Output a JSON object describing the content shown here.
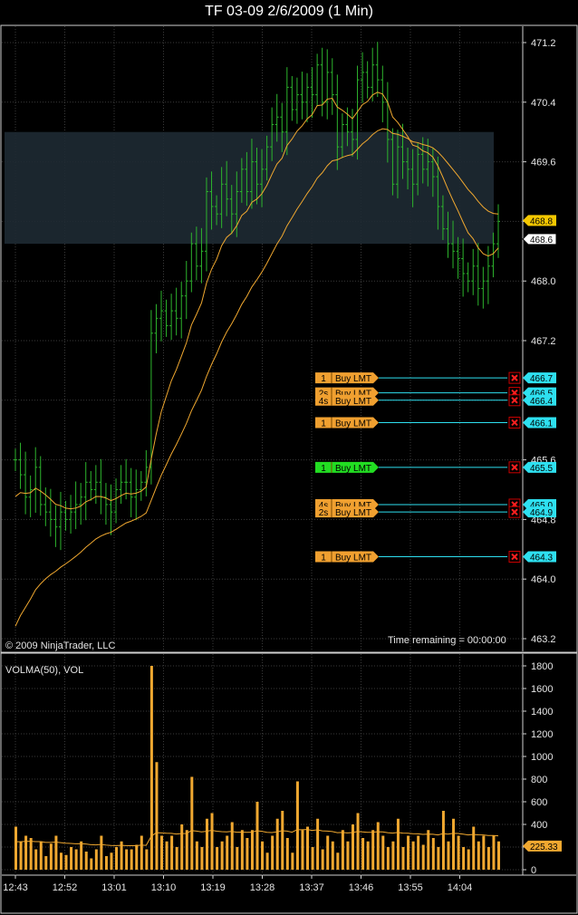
{
  "window": {
    "title": "TF 03-09  2/6/2009 (1 Min)"
  },
  "price_panel": {
    "copyright": "© 2009 NinjaTrader, LLC",
    "time_remaining": "Time remaining = 00:00:00",
    "last_price_label": "468.8",
    "ask_price_label": "468.6"
  },
  "volume_panel": {
    "label": "VOLMA(50), VOL",
    "current_volma_label": "225.33"
  },
  "colors": {
    "background": "#000000",
    "bars": "#2db52d",
    "moving_average": "#f0a830",
    "volume": "#f0a830",
    "order_orange": "#f0a030",
    "order_green": "#22dd22",
    "order_line": "#2ee0f0",
    "zone": "#1e2a33"
  },
  "orders": [
    {
      "qty": "1",
      "type": "Buy LMT",
      "price": "466.7",
      "color": "orange"
    },
    {
      "qty": "2s",
      "type": "Buy LMT",
      "price": "466.5",
      "color": "orange"
    },
    {
      "qty": "4s",
      "type": "Buy LMT",
      "price": "466.4",
      "color": "orange"
    },
    {
      "qty": "1",
      "type": "Buy LMT",
      "price": "466.1",
      "color": "orange"
    },
    {
      "qty": "1",
      "type": "Buy LMT",
      "price": "465.5",
      "color": "green"
    },
    {
      "qty": "4s",
      "type": "Buy LMT",
      "price": "465.0",
      "color": "orange"
    },
    {
      "qty": "2s",
      "type": "Buy LMT",
      "price": "464.9",
      "color": "orange"
    },
    {
      "qty": "1",
      "type": "Buy LMT",
      "price": "464.3",
      "color": "orange"
    }
  ],
  "chart_data": {
    "type": "ohlc_with_volume",
    "instrument": "TF 03-09",
    "date": "2/6/2009",
    "interval": "1 Min",
    "price_axis": {
      "ylim": [
        463.0,
        471.4
      ],
      "ticks": [
        "471.2",
        "470.4",
        "469.6",
        "468.8",
        "468.0",
        "467.2",
        "466.4",
        "465.6",
        "464.8",
        "464.0",
        "463.2"
      ]
    },
    "volume_axis": {
      "ylim": [
        0,
        1800
      ],
      "ticks": [
        "0",
        "200",
        "400",
        "600",
        "800",
        "1000",
        "1200",
        "1400",
        "1600",
        "1800"
      ]
    },
    "x_ticks": [
      "12:43",
      "12:52",
      "13:01",
      "13:10",
      "13:19",
      "13:28",
      "13:37",
      "13:46",
      "13:55",
      "14:04"
    ],
    "zone": {
      "from": 468.5,
      "to": 470.0
    },
    "price_close": [
      465.6,
      465.4,
      465.1,
      465.2,
      465.5,
      465.0,
      464.9,
      464.8,
      464.7,
      464.9,
      464.8,
      464.9,
      465.0,
      465.1,
      465.3,
      465.2,
      465.3,
      465.1,
      465.0,
      464.9,
      465.2,
      465.3,
      465.3,
      465.1,
      465.2,
      465.3,
      465.5,
      467.3,
      467.5,
      467.6,
      467.4,
      467.6,
      467.5,
      467.8,
      468.0,
      468.5,
      468.2,
      468.4,
      469.2,
      469.0,
      468.9,
      469.3,
      469.1,
      468.9,
      469.2,
      469.5,
      469.2,
      469.6,
      469.3,
      469.5,
      469.8,
      470.1,
      470.2,
      470.0,
      470.6,
      470.3,
      470.5,
      470.4,
      470.6,
      470.5,
      470.9,
      470.4,
      470.8,
      470.5,
      469.8,
      470.1,
      470.0,
      469.9,
      470.7,
      470.8,
      470.6,
      470.9,
      470.7,
      470.4,
      469.9,
      469.3,
      469.8,
      469.6,
      469.5,
      469.3,
      469.7,
      469.5,
      469.6,
      469.4,
      469.0,
      468.7,
      468.5,
      468.4,
      468.3,
      468.1,
      468.0,
      468.2,
      467.9,
      468.0,
      468.2,
      468.5,
      468.8
    ],
    "volma_level": 225.33,
    "volume": [
      380,
      250,
      300,
      280,
      180,
      250,
      120,
      230,
      300,
      150,
      130,
      200,
      180,
      250,
      160,
      100,
      180,
      300,
      120,
      150,
      200,
      250,
      180,
      180,
      220,
      300,
      180,
      1800,
      950,
      300,
      250,
      300,
      200,
      400,
      350,
      820,
      250,
      200,
      450,
      500,
      200,
      250,
      300,
      420,
      200,
      350,
      280,
      350,
      600,
      250,
      150,
      300,
      450,
      520,
      280,
      150,
      780,
      350,
      380,
      200,
      450,
      180,
      300,
      250,
      150,
      350,
      250,
      400,
      500,
      280,
      250,
      350,
      420,
      300,
      200,
      250,
      450,
      200,
      300,
      250,
      300,
      220,
      350,
      280,
      200,
      520,
      250,
      450,
      300,
      200,
      180,
      380,
      250,
      300,
      200,
      300,
      250
    ]
  }
}
